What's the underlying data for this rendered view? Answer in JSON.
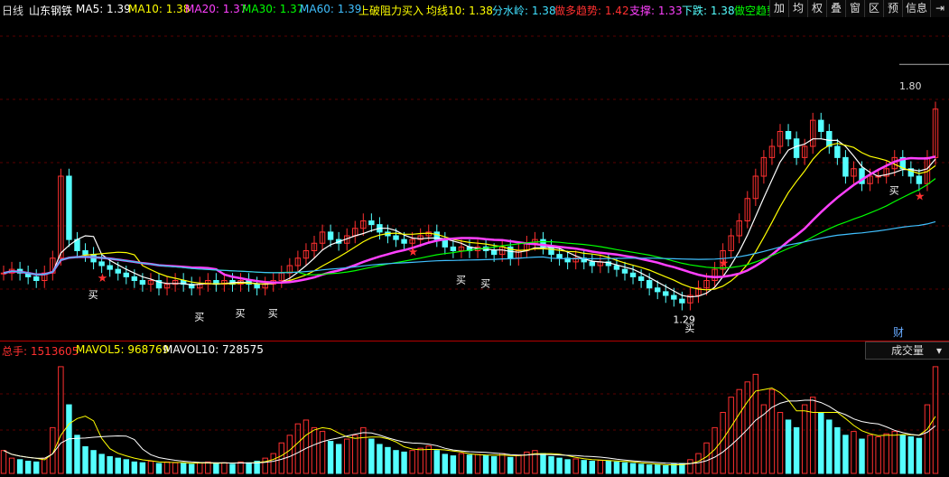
{
  "header": {
    "period": "日线",
    "stock_name": "山东钢铁",
    "ma5": "MA5: 1.39",
    "ma10": "MA10: 1.38",
    "ma20": "MA20: 1.37",
    "ma30": "MA30: 1.37",
    "ma60": "MA60: 1.39",
    "signal_buy": "上破阻力买入",
    "avg10": "均线10: 1.38",
    "watershed": "分水岭: 1.38",
    "bull_trend": "做多趋势: 1.42",
    "support": "支撑: 1.33",
    "decline": "下跌: 1.38",
    "short_trend": "做空趋势"
  },
  "toolbar": {
    "buttons": [
      "加",
      "均",
      "权",
      "叠",
      "窗",
      "区",
      "预",
      "信息"
    ]
  },
  "price_axis_label": "1.80",
  "finance_badge": "财",
  "low_marker": "1.29",
  "buy_marker": "买",
  "volume_header": {
    "total": "总手: 1513605",
    "mavol5": "MAVOL5: 968769",
    "mavol10": "MAVOL10: 728575",
    "selector": "成交量"
  },
  "colors": {
    "up": "#ff3030",
    "down": "#54ffff",
    "ma5": "#ffffff",
    "ma10": "#ffff00",
    "ma20": "#ff40ff",
    "ma30": "#00ff00",
    "ma60": "#40c0ff"
  },
  "chart_data": {
    "type": "candlestick",
    "closes": [
      1.24,
      1.25,
      1.24,
      1.23,
      1.22,
      1.24,
      1.28,
      1.5,
      1.33,
      1.3,
      1.29,
      1.27,
      1.26,
      1.25,
      1.24,
      1.23,
      1.22,
      1.21,
      1.22,
      1.2,
      1.21,
      1.22,
      1.21,
      1.2,
      1.21,
      1.22,
      1.21,
      1.22,
      1.21,
      1.22,
      1.21,
      1.2,
      1.21,
      1.22,
      1.24,
      1.26,
      1.28,
      1.3,
      1.32,
      1.35,
      1.33,
      1.32,
      1.34,
      1.36,
      1.38,
      1.37,
      1.35,
      1.34,
      1.33,
      1.32,
      1.33,
      1.34,
      1.35,
      1.33,
      1.31,
      1.3,
      1.31,
      1.3,
      1.31,
      1.3,
      1.29,
      1.31,
      1.28,
      1.3,
      1.32,
      1.33,
      1.31,
      1.29,
      1.28,
      1.27,
      1.28,
      1.27,
      1.26,
      1.27,
      1.26,
      1.25,
      1.24,
      1.23,
      1.22,
      1.2,
      1.19,
      1.18,
      1.17,
      1.16,
      1.18,
      1.2,
      1.22,
      1.25,
      1.3,
      1.34,
      1.38,
      1.44,
      1.5,
      1.55,
      1.58,
      1.62,
      1.6,
      1.55,
      1.58,
      1.65,
      1.62,
      1.58,
      1.55,
      1.5,
      1.52,
      1.48,
      1.5,
      1.5,
      1.52,
      1.55,
      1.52,
      1.5,
      1.48,
      1.55,
      1.68
    ],
    "volumes": [
      300,
      200,
      180,
      160,
      150,
      200,
      600,
      1400,
      900,
      500,
      350,
      300,
      250,
      220,
      200,
      180,
      150,
      140,
      160,
      130,
      150,
      140,
      130,
      120,
      140,
      150,
      130,
      140,
      120,
      150,
      140,
      160,
      200,
      260,
      400,
      500,
      650,
      700,
      600,
      550,
      420,
      380,
      450,
      500,
      600,
      450,
      380,
      340,
      300,
      280,
      300,
      330,
      360,
      300,
      250,
      230,
      260,
      240,
      250,
      230,
      220,
      260,
      210,
      240,
      280,
      300,
      260,
      220,
      200,
      180,
      190,
      170,
      160,
      170,
      160,
      150,
      140,
      130,
      120,
      110,
      110,
      100,
      120,
      130,
      180,
      260,
      400,
      600,
      800,
      1000,
      1100,
      1200,
      1300,
      900,
      1100,
      800,
      700,
      600,
      900,
      1000,
      800,
      700,
      600,
      500,
      550,
      450,
      500,
      480,
      520,
      550,
      500,
      480,
      460,
      900,
      1400
    ],
    "last_close": 1.68,
    "price_marker": 1.8,
    "total_volume": 1513605,
    "mavol5": 968769,
    "mavol10": 728575
  }
}
